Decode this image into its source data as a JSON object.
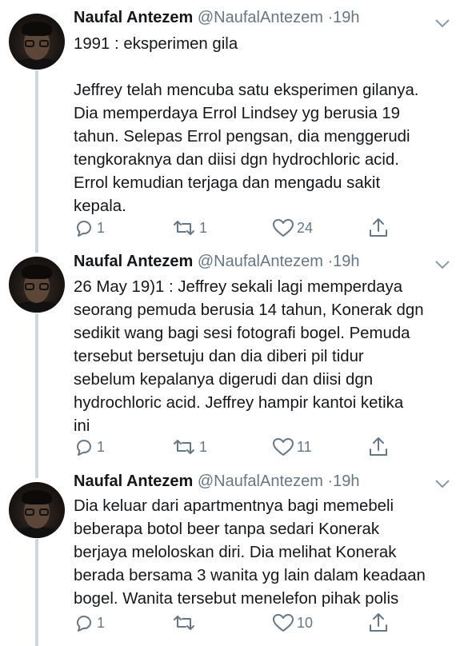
{
  "tweets": [
    {
      "name": "Naufal Antezem",
      "handle": "@NaufalAntezem",
      "dot": "·",
      "time": "19h",
      "lines": [
        "1991 : eksperimen gila",
        "",
        "Jeffrey telah mencuba satu eksperimen gilanya.",
        "Dia memperdaya Errol Lindsey yg berusia 19",
        "tahun. Selepas Errol pengsan, dia menggerudi",
        "tengkoraknya dan diisi dgn hydrochloric acid.",
        "Errol kemudian terjaga dan mengadu sakit",
        "kepala."
      ],
      "reply_count": "1",
      "retweet_count": "1",
      "like_count": "24"
    },
    {
      "name": "Naufal Antezem",
      "handle": "@NaufalAntezem",
      "dot": "·",
      "time": "19h",
      "lines": [
        "26 May 19)1 : Jeffrey sekali lagi memperdaya",
        "seorang pemuda berusia 14 tahun, Konerak dgn",
        "sedikit wang bagi sesi fotografi bogel. Pemuda",
        "tersebut bersetuju dan dia diberi pil tidur",
        "sebelum kepalanya digerudi dan diisi dgn",
        "hydrochloric acid. Jeffrey hampir kantoi ketika",
        "ini"
      ],
      "reply_count": "1",
      "retweet_count": "1",
      "like_count": "11"
    },
    {
      "name": "Naufal Antezem",
      "handle": "@NaufalAntezem",
      "dot": "·",
      "time": "19h",
      "lines": [
        "Dia keluar dari apartmentnya bagi memebeli",
        "beberapa botol beer tanpa sedari Konerak",
        "berjaya meloloskan diri. Dia melihat Konerak",
        "berada bersama 3 wanita yg lain dalam keadaan",
        "bogel. Wanita tersebut menelefon pihak polis"
      ],
      "reply_count": "1",
      "retweet_count": "",
      "like_count": "10"
    }
  ],
  "icons": {
    "reply": "reply-icon",
    "retweet": "retweet-icon",
    "like": "heart-icon",
    "share": "share-icon",
    "caret": "chevron-down-icon"
  },
  "colors": {
    "text": "#14171a",
    "secondary": "#657786",
    "thread_line": "#ccd6dd"
  }
}
